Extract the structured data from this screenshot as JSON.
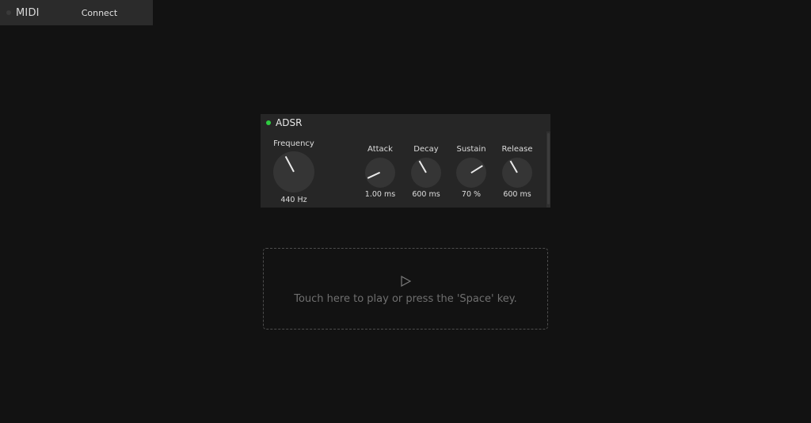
{
  "midi": {
    "label": "MIDI",
    "connect_label": "Connect"
  },
  "panel": {
    "title": "ADSR",
    "status_color": "#2ecc40",
    "knobs": {
      "frequency": {
        "label": "Frequency",
        "value": "440 Hz"
      },
      "attack": {
        "label": "Attack",
        "value": "1.00 ms"
      },
      "decay": {
        "label": "Decay",
        "value": "600 ms"
      },
      "sustain": {
        "label": "Sustain",
        "value": "70 %"
      },
      "release": {
        "label": "Release",
        "value": "600 ms"
      }
    }
  },
  "play_area": {
    "icon": "play-icon",
    "text": "Touch here to play or press the 'Space' key."
  }
}
